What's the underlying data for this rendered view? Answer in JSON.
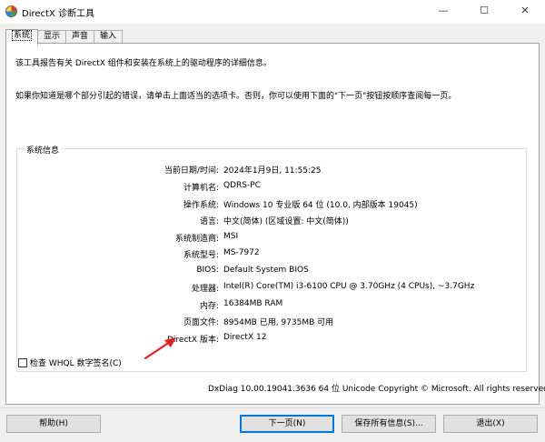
{
  "window": {
    "title": "DirectX 诊断工具",
    "min_glyph": "—",
    "max_glyph": "☐",
    "close_glyph": "✕"
  },
  "tabs": [
    {
      "label": "系统"
    },
    {
      "label": "显示"
    },
    {
      "label": "声音"
    },
    {
      "label": "输入"
    }
  ],
  "intro": {
    "line1": "该工具报告有关 DirectX 组件和安装在系统上的驱动程序的详细信息。",
    "line2": "如果你知道是哪个部分引起的错误，请单击上面适当的选项卡。否则，你可以使用下面的\"下一页\"按钮按顺序查阅每一页。"
  },
  "system_info": {
    "group_label": "系统信息",
    "rows": [
      {
        "label": "当前日期/时间:",
        "value": "2024年1月9日, 11:55:25"
      },
      {
        "label": "计算机名:",
        "value": "QDRS-PC"
      },
      {
        "label": "操作系统:",
        "value": "Windows 10 专业版 64 位 (10.0, 内部版本 19045)"
      },
      {
        "label": "语言:",
        "value": "中文(简体) (区域设置: 中文(简体))"
      },
      {
        "label": "系统制造商:",
        "value": "MSI"
      },
      {
        "label": "系统型号:",
        "value": "MS-7972"
      },
      {
        "label": "BIOS:",
        "value": "Default System BIOS"
      },
      {
        "label": "处理器:",
        "value": "Intel(R) Core(TM) i3-6100 CPU @ 3.70GHz (4 CPUs), ~3.7GHz"
      },
      {
        "label": "内存:",
        "value": "16384MB RAM"
      },
      {
        "label": "页面文件:",
        "value": "8954MB 已用, 9735MB 可用"
      },
      {
        "label": "DirectX 版本:",
        "value": "DirectX 12"
      }
    ]
  },
  "whql": {
    "label": "检查 WHQL 数字签名(C)",
    "checked": false
  },
  "copyright": "DxDiag 10.00.19041.3636 64 位 Unicode  Copyright © Microsoft. All rights reserved.",
  "buttons": {
    "help": "帮助(H)",
    "next": "下一页(N)",
    "save": "保存所有信息(S)...",
    "exit": "退出(X)"
  },
  "colors": {
    "annotation_arrow": "#e02020",
    "primary_button_border": "#0078d7"
  }
}
